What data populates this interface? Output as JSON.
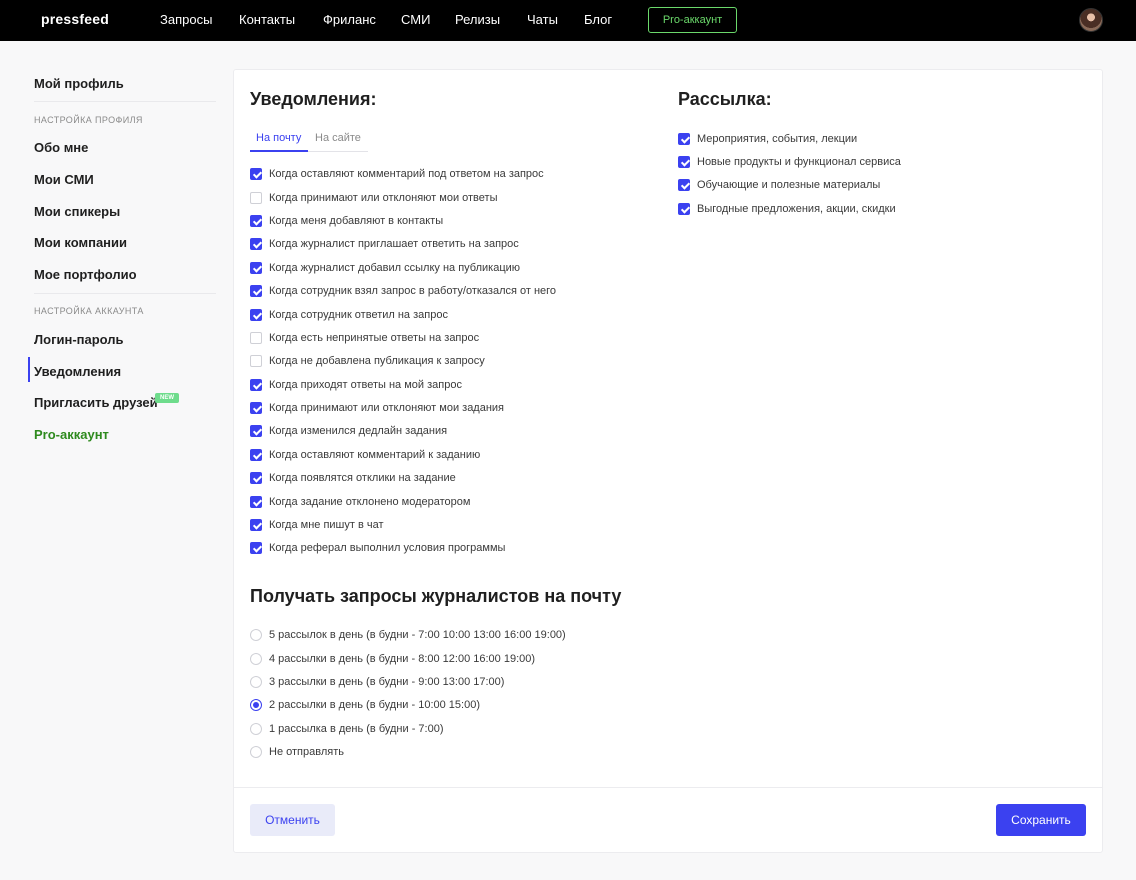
{
  "header": {
    "logo": "pressfeed",
    "nav": [
      "Запросы",
      "Контакты",
      "Фриланс",
      "СМИ",
      "Релизы",
      "Чаты",
      "Блог"
    ],
    "pro_button": "Pro-аккаунт"
  },
  "sidebar": {
    "my_profile": "Мой профиль",
    "section_profile": "НАСТРОЙКА ПРОФИЛЯ",
    "about": "Обо мне",
    "my_media": "Мои СМИ",
    "my_speakers": "Мои спикеры",
    "my_companies": "Мои компании",
    "my_portfolio": "Мое портфолио",
    "section_account": "НАСТРОЙКА АККАУНТА",
    "login_password": "Логин-пароль",
    "notifications": "Уведомления",
    "invite_friends": "Пригласить друзей",
    "new_badge": "NEW",
    "pro_account": "Pro-аккаунт"
  },
  "notifications": {
    "title": "Уведомления:",
    "tabs": [
      "На почту",
      "На сайте"
    ],
    "items": [
      {
        "label": "Когда оставляют комментарий под ответом на запрос",
        "checked": true
      },
      {
        "label": "Когда принимают или отклоняют мои ответы",
        "checked": false
      },
      {
        "label": "Когда меня добавляют в контакты",
        "checked": true
      },
      {
        "label": "Когда журналист приглашает ответить на запрос",
        "checked": true
      },
      {
        "label": "Когда журналист добавил ссылку на публикацию",
        "checked": true
      },
      {
        "label": "Когда сотрудник взял запрос в работу/отказался от него",
        "checked": true
      },
      {
        "label": "Когда сотрудник ответил на запрос",
        "checked": true
      },
      {
        "label": "Когда есть непринятые ответы на запрос",
        "checked": false
      },
      {
        "label": "Когда не добавлена публикация к запросу",
        "checked": false
      },
      {
        "label": "Когда приходят ответы на мой запрос",
        "checked": true
      },
      {
        "label": "Когда принимают или отклоняют мои задания",
        "checked": true
      },
      {
        "label": "Когда изменился дедлайн задания",
        "checked": true
      },
      {
        "label": "Когда оставляют комментарий к заданию",
        "checked": true
      },
      {
        "label": "Когда появлятся отклики на задание",
        "checked": true
      },
      {
        "label": "Когда задание отклонено модератором",
        "checked": true
      },
      {
        "label": "Когда мне пишут в чат",
        "checked": true
      },
      {
        "label": "Когда реферал выполнил условия программы",
        "checked": true
      }
    ]
  },
  "mailing": {
    "title": "Рассылка:",
    "items": [
      {
        "label": "Мероприятия, события, лекции",
        "checked": true
      },
      {
        "label": "Новые продукты и функционал сервиса",
        "checked": true
      },
      {
        "label": "Обучающие и полезные материалы",
        "checked": true
      },
      {
        "label": "Выгодные предложения, акции, скидки",
        "checked": true
      }
    ]
  },
  "requests": {
    "title": "Получать запросы журналистов на почту",
    "options": [
      {
        "label": "5 рассылок в день (в будни - 7:00 10:00 13:00 16:00 19:00)",
        "selected": false
      },
      {
        "label": "4 рассылки в день (в будни - 8:00 12:00 16:00 19:00)",
        "selected": false
      },
      {
        "label": "3 рассылки в день (в будни - 9:00 13:00 17:00)",
        "selected": false
      },
      {
        "label": "2 рассылки в день (в будни - 10:00 15:00)",
        "selected": true
      },
      {
        "label": "1 рассылка в день (в будни - 7:00)",
        "selected": false
      },
      {
        "label": "Не отправлять",
        "selected": false
      }
    ]
  },
  "actions": {
    "cancel": "Отменить",
    "save": "Сохранить"
  },
  "colors": {
    "accent": "#3b41f0",
    "pro_green": "#6bd96b",
    "header_bg": "#000000"
  }
}
